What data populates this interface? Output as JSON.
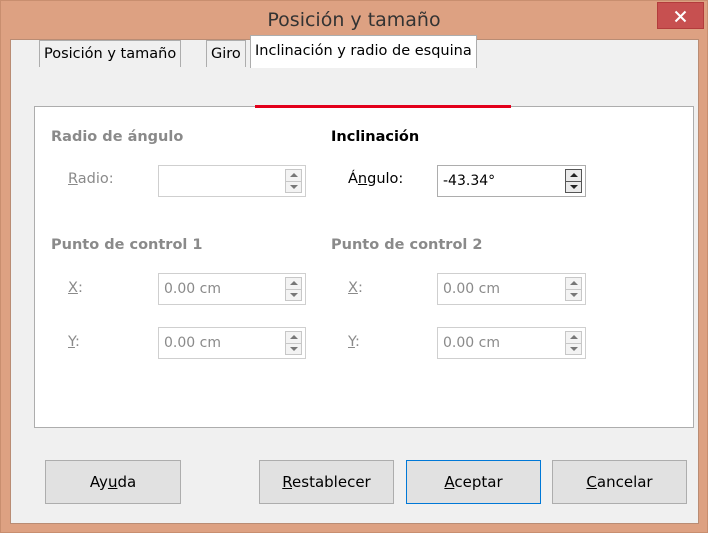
{
  "window": {
    "title": "Posición y tamaño"
  },
  "tabs": [
    {
      "label": "Posición y tamaño"
    },
    {
      "label": "Giro"
    },
    {
      "label": "Inclinación y radio de esquina"
    }
  ],
  "corner_radius": {
    "heading": "Radio de ángulo",
    "radius_label_pre": "",
    "radius_label_ul": "R",
    "radius_label_post": "adio:",
    "radius_value": ""
  },
  "slant": {
    "heading": "Inclinación",
    "angle_label_pre": "Á",
    "angle_label_ul": "n",
    "angle_label_post": "gulo:",
    "angle_value": "-43.34°"
  },
  "control_point_1": {
    "heading": "Punto de control 1",
    "x_label_ul": "X",
    "x_label_post": ":",
    "x_value": "0.00 cm",
    "y_label_ul": "Y",
    "y_label_post": ":",
    "y_value": "0.00 cm"
  },
  "control_point_2": {
    "heading": "Punto de control 2",
    "x_label_ul": "X",
    "x_label_post": ":",
    "x_value": "0.00 cm",
    "y_label_ul": "Y",
    "y_label_post": ":",
    "y_value": "0.00 cm"
  },
  "buttons": {
    "help_pre": "Ay",
    "help_ul": "u",
    "help_post": "da",
    "reset_pre": "",
    "reset_ul": "R",
    "reset_post": "establecer",
    "ok_pre": "",
    "ok_ul": "A",
    "ok_post": "ceptar",
    "cancel_pre": "",
    "cancel_ul": "C",
    "cancel_post": "ancelar"
  },
  "colors": {
    "titlebar": "#dda182",
    "close_button": "#c75050",
    "active_tab_underline": "#e3001b",
    "default_button_border": "#0078d7"
  }
}
